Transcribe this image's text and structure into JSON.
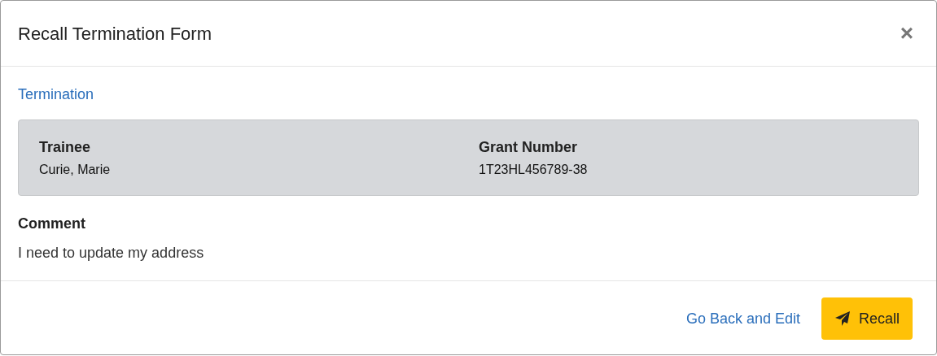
{
  "dialog": {
    "title": "Recall Termination Form",
    "close": "×"
  },
  "section": {
    "title": "Termination"
  },
  "summary": [
    {
      "label": "Trainee",
      "value": "Curie, Marie"
    },
    {
      "label": "Grant Number",
      "value": "1T23HL456789-38"
    }
  ],
  "comment": {
    "label": "Comment",
    "text": "I need to update my address"
  },
  "footer": {
    "link": "Go Back and Edit",
    "button": "Recall"
  }
}
